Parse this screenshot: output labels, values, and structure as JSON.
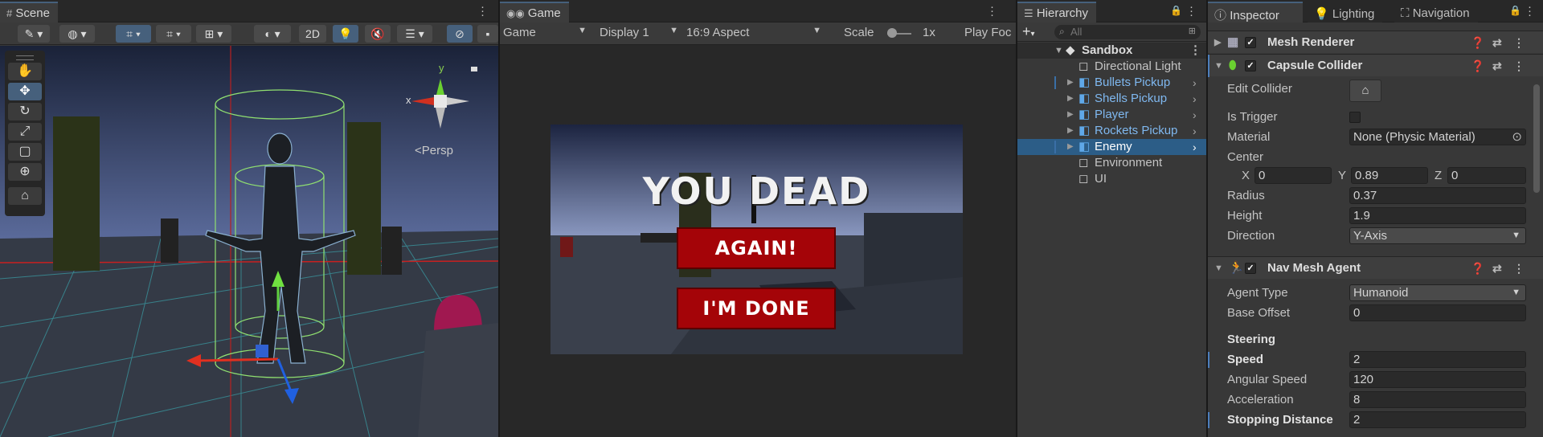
{
  "scene": {
    "tab_label": "Scene",
    "two_d_label": "2D",
    "persp_label": "Persp",
    "gizmo_y": "y",
    "gizmo_x": "x",
    "tools": [
      "hand-tool",
      "move-tool",
      "rotate-tool",
      "scale-tool",
      "rect-tool",
      "transform-tool",
      "custom-tool"
    ]
  },
  "game": {
    "tab_label": "Game",
    "mode_label": "Game",
    "display_label": "Display 1",
    "aspect_label": "16:9 Aspect",
    "scale_label": "Scale",
    "scale_value": "1x",
    "play_focused_label": "Play Foc",
    "screen_title": "YOU DEAD",
    "again_button": "AGAIN!",
    "done_button": "I'M DONE"
  },
  "hierarchy": {
    "tab_label": "Hierarchy",
    "search_placeholder": "All",
    "scene_name": "Sandbox",
    "items": [
      {
        "name": "Directional Light",
        "prefab": false,
        "arrow": false
      },
      {
        "name": "Bullets Pickup",
        "prefab": true,
        "arrow": true
      },
      {
        "name": "Shells Pickup",
        "prefab": true,
        "arrow": true
      },
      {
        "name": "Player",
        "prefab": true,
        "arrow": true
      },
      {
        "name": "Rockets Pickup",
        "prefab": true,
        "arrow": true
      },
      {
        "name": "Enemy",
        "prefab": true,
        "arrow": true,
        "selected": true
      },
      {
        "name": "Environment",
        "prefab": false,
        "arrow": false
      },
      {
        "name": "UI",
        "prefab": false,
        "arrow": false
      }
    ]
  },
  "inspector": {
    "tabs": [
      "Inspector",
      "Lighting",
      "Navigation"
    ],
    "mesh_renderer": "Mesh Renderer",
    "capsule_collider": {
      "title": "Capsule Collider",
      "edit_collider": "Edit Collider",
      "is_trigger": "Is Trigger",
      "material_label": "Material",
      "material_value": "None (Physic Material)",
      "center_label": "Center",
      "cx_label": "X",
      "cx": "0",
      "cy_label": "Y",
      "cy": "0.89",
      "cz_label": "Z",
      "cz": "0",
      "radius_label": "Radius",
      "radius": "0.37",
      "height_label": "Height",
      "height": "1.9",
      "direction_label": "Direction",
      "direction": "Y-Axis"
    },
    "nav_mesh_agent": {
      "title": "Nav Mesh Agent",
      "agent_type_label": "Agent Type",
      "agent_type": "Humanoid",
      "base_offset_label": "Base Offset",
      "base_offset": "0",
      "steering_label": "Steering",
      "speed_label": "Speed",
      "speed": "2",
      "angular_speed_label": "Angular Speed",
      "angular_speed": "120",
      "acceleration_label": "Acceleration",
      "acceleration": "8",
      "stopping_distance_label": "Stopping Distance",
      "stopping_distance": "2"
    }
  },
  "colors": {
    "selection": "#2c5d87",
    "prefab_text": "#7fb8f0",
    "game_button": "#a40408"
  }
}
